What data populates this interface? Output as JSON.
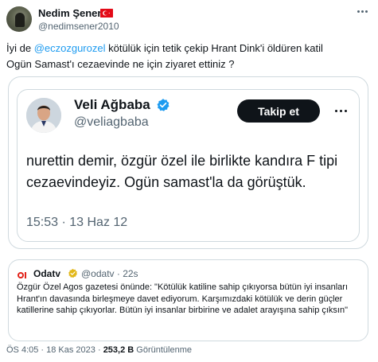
{
  "author": {
    "name": "Nedim Şener",
    "handle": "@nedimsener2010",
    "flag_icon": "turkey-flag-icon"
  },
  "tweet": {
    "text_prefix": "İyi de ",
    "mention": "@eczozgurozel",
    "text_line1_rest": " kötülük için tetik çekip Hrant Dink'i öldüren katil",
    "text_line2": "Ogün Samast'ı cezaevinde ne için ziyaret ettiniz ?"
  },
  "screenshot": {
    "name": "Veli Ağbaba",
    "handle": "@veliagbaba",
    "follow_label": "Takip et",
    "text": "nurettin demir, özgür özel ile birlikte kandıra F tipi cezaevindeyiz. Ogün samast'la da görüştük.",
    "time": "15:53 · 13 Haz 12"
  },
  "quote": {
    "name": "Odatv",
    "handle_time": "@odatv · 22s",
    "text": "Özgür Özel Agos gazetesi önünde: \"Kötülük katiline sahip çıkıyorsa bütün iyi insanları Hrant'ın davasında birleşmeye davet ediyorum. Karşımızdaki kötülük ve derin güçler katillerine sahip çıkıyorlar. Bütün iyi insanlar birbirine ve adalet arayışına sahip çıksın\""
  },
  "footer": {
    "time_date": "ÖS 4:05 · 18 Kas 2023 · ",
    "views_count": "253,2 B",
    "views_label": " Görüntülenme"
  },
  "colors": {
    "accent": "#1d9bf0",
    "text": "#0f1419",
    "muted": "#536471",
    "border": "#cfd9de",
    "flag_red": "#e30a17"
  }
}
